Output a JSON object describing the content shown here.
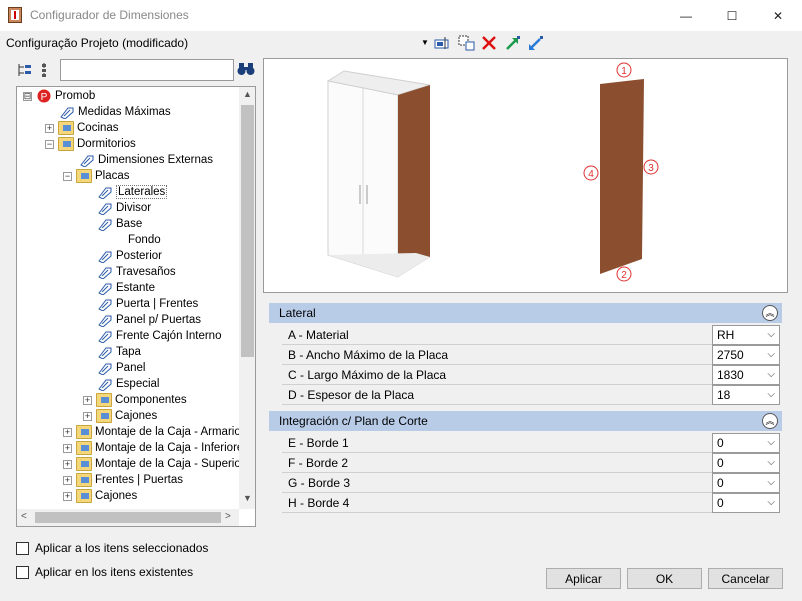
{
  "window": {
    "title": "Configurador de Dimensiones",
    "min_glyph": "—",
    "max_glyph": "☐",
    "close_glyph": "✕"
  },
  "header": {
    "config_name": "Configuração Projeto (modificado)",
    "dropdown_glyph": "▼"
  },
  "tree": {
    "items": [
      {
        "label": "Promob",
        "exp": "⊟"
      },
      {
        "label": "Medidas Máximas"
      },
      {
        "label": "Cocinas",
        "exp": "+"
      },
      {
        "label": "Dormitorios",
        "exp": "−"
      },
      {
        "label": "Dimensiones Externas"
      },
      {
        "label": "Placas",
        "exp": "−"
      },
      {
        "label": "Laterales"
      },
      {
        "label": "Divisor"
      },
      {
        "label": "Base"
      },
      {
        "label": "Fondo"
      },
      {
        "label": "Posterior"
      },
      {
        "label": "Travesaños"
      },
      {
        "label": "Estante"
      },
      {
        "label": "Puerta | Frentes"
      },
      {
        "label": "Panel p/ Puertas"
      },
      {
        "label": "Frente Cajón Interno"
      },
      {
        "label": "Tapa"
      },
      {
        "label": "Panel"
      },
      {
        "label": "Especial"
      },
      {
        "label": "Componentes",
        "exp": "+"
      },
      {
        "label": "Cajones",
        "exp": "+"
      },
      {
        "label": "Montaje de la Caja - Armarios",
        "exp": "+"
      },
      {
        "label": "Montaje de la Caja - Inferiores",
        "exp": "+"
      },
      {
        "label": "Montaje de la Caja - Superior",
        "exp": "+"
      },
      {
        "label": "Frentes | Puertas",
        "exp": "+"
      },
      {
        "label": "Cajones",
        "exp": "+"
      }
    ],
    "scroll_up": "▲",
    "scroll_down": "▼",
    "scroll_left": "<",
    "scroll_right": ">"
  },
  "preview": {
    "edge_labels": [
      "1",
      "2",
      "3",
      "4"
    ],
    "colors": {
      "wood": "#8b4f2f",
      "cabinet": "#f5f5f5"
    }
  },
  "sections": [
    {
      "title": "Lateral",
      "collapse_glyph": "︽",
      "rows": [
        {
          "label": "A - Material",
          "value": "RH"
        },
        {
          "label": "B -  Ancho Máximo de la Placa",
          "value": "2750"
        },
        {
          "label": "C - Largo Máximo de la Placa",
          "value": "1830"
        },
        {
          "label": "D - Espesor de la Placa",
          "value": "18"
        }
      ]
    },
    {
      "title": "Integración c/ Plan de Corte",
      "collapse_glyph": "︽",
      "rows": [
        {
          "label": "E - Borde 1",
          "value": "0"
        },
        {
          "label": "F - Borde 2",
          "value": "0"
        },
        {
          "label": "G - Borde 3",
          "value": "0"
        },
        {
          "label": "H - Borde 4",
          "value": "0"
        }
      ]
    }
  ],
  "select_arrow": "⌵",
  "checkboxes": [
    {
      "label": "Aplicar a los itens seleccionados"
    },
    {
      "label": "Aplicar en los itens existentes"
    }
  ],
  "buttons": {
    "apply": "Aplicar",
    "ok": "OK",
    "cancel": "Cancelar"
  }
}
